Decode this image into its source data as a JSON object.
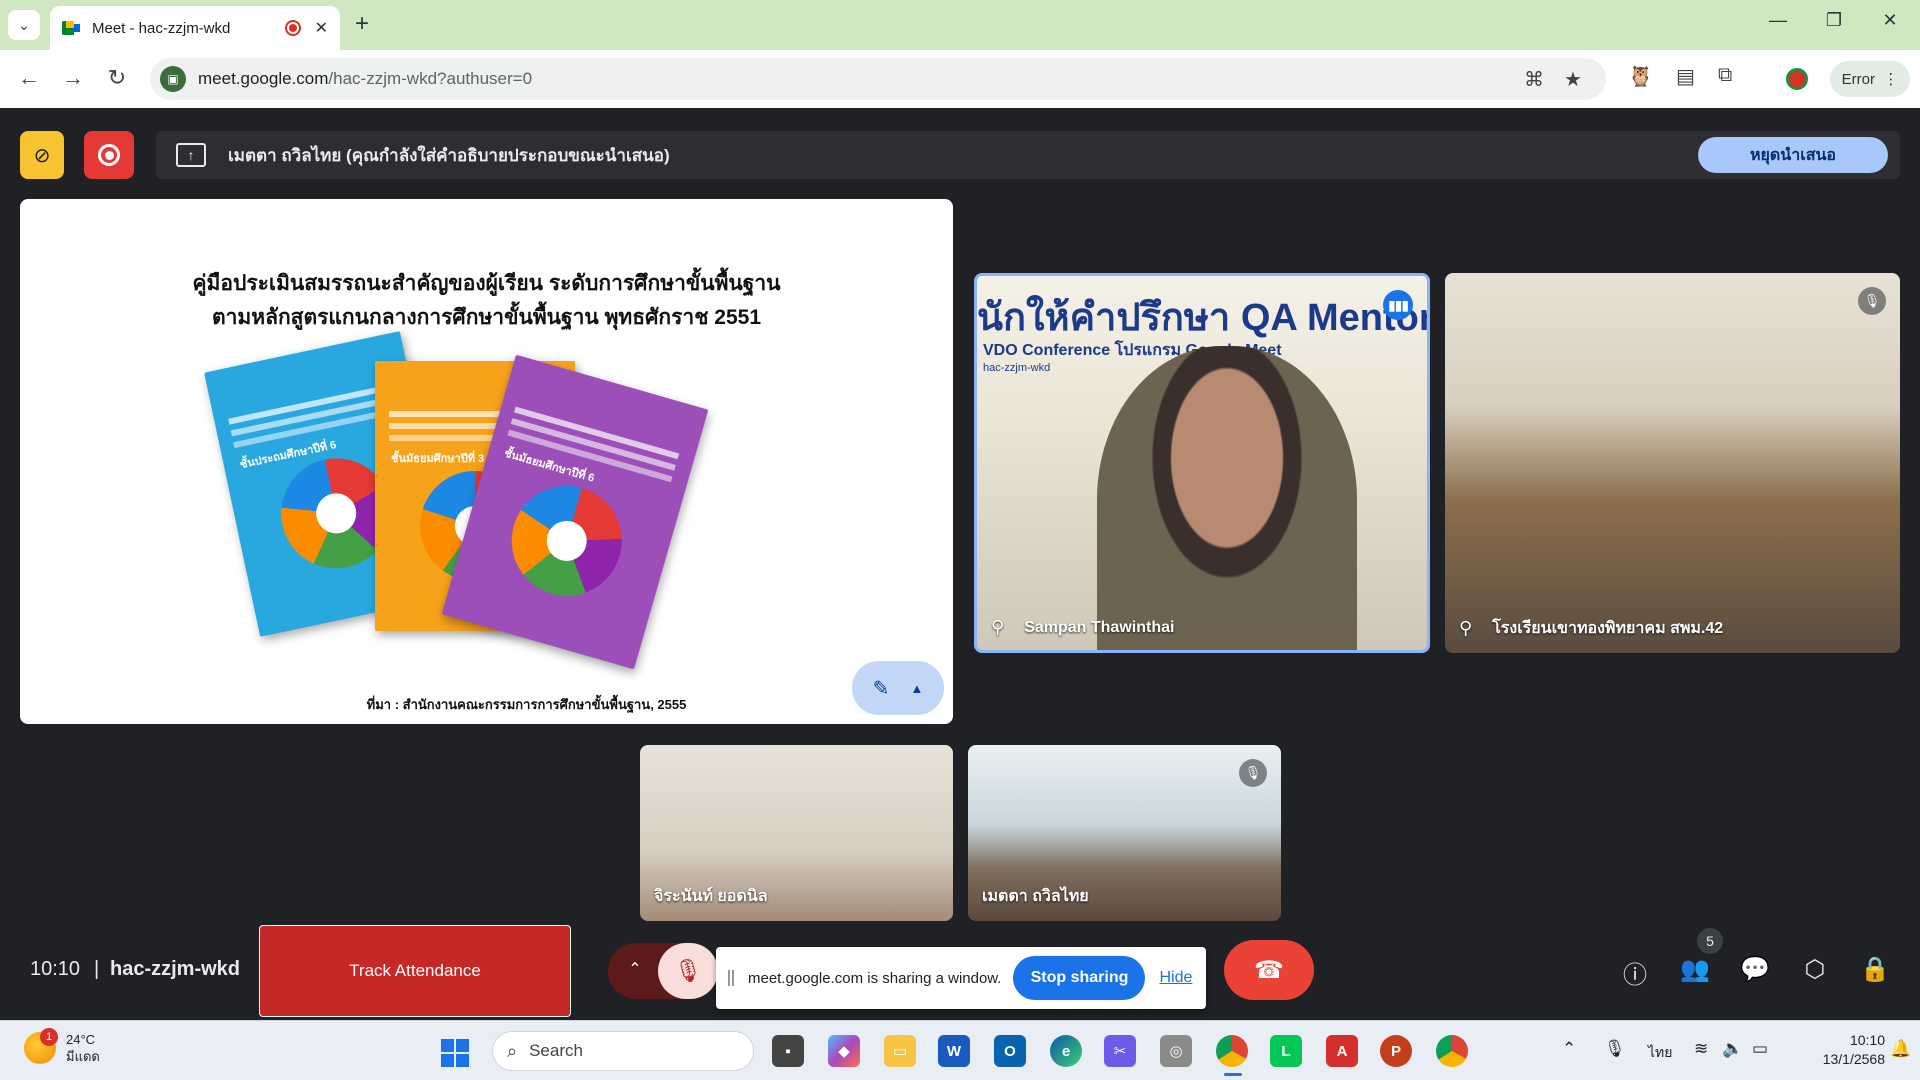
{
  "browser": {
    "tab_title": "Meet - hac-zzjm-wkd",
    "tab_close": "✕",
    "new_tab": "+",
    "url_host": "meet.google.com",
    "url_path": "/hac-zzjm-wkd?authuser=0",
    "profile_label": "Error",
    "window_controls": [
      "—",
      "❐",
      "✕"
    ]
  },
  "presenting": {
    "message": "เมตตา ถวิลไทย (คุณกำลังใส่คำอธิบายประกอบขณะนำเสนอ)",
    "stop_button": "หยุดนำเสนอ"
  },
  "slide": {
    "title_line1": "คู่มือประเมินสมรรถนะสำคัญของผู้เรียน ระดับการศึกษาขั้นพื้นฐาน",
    "title_line2": "ตามหลักสูตรแกนกลางการศึกษาขั้นพื้นฐาน พุทธศักราช 2551",
    "books": [
      {
        "label": "ชั้นประถมศึกษาปีที่ 6",
        "color": "#29a8e0"
      },
      {
        "label": "ชั้นมัธยมศึกษาปีที่ 3",
        "color": "#f7a21b"
      },
      {
        "label": "ชั้นมัธยมศึกษาปีที่ 6",
        "color": "#9c4fb8"
      }
    ],
    "source": "ที่มา : สำนักงานคณะกรรมการการศึกษาขั้นพื้นฐาน, 2555"
  },
  "participants": [
    {
      "name": "Sampan Thawinthai",
      "banner": "นักให้คำปรึกษา QA Mentor",
      "banner_sub": "VDO Conference โปรแกรม Google Meet",
      "banner_small": "hac-zzjm-wkd"
    },
    {
      "name": "โรงเรียนเขาทองพิทยาคม สพม.42"
    },
    {
      "name": "จิระนันท์ ยอดนิล"
    },
    {
      "name": "เมตตา ถวิลไทย"
    }
  ],
  "meeting": {
    "time": "10:10",
    "separator": "|",
    "code": "hac-zzjm-wkd",
    "track_attendance": "Track Attendance",
    "share_notice": "meet.google.com is sharing a window.",
    "stop_sharing": "Stop sharing",
    "hide": "Hide",
    "people_count": "5"
  },
  "taskbar": {
    "weather_temp": "24°C",
    "weather_desc": "มีแดด",
    "weather_badge": "1",
    "search_placeholder": "Search",
    "lang": "ไทย",
    "clock_time": "10:10",
    "clock_date": "13/1/2568"
  },
  "colors": {
    "tab_strip": "#cfe8c2",
    "meet_bg": "#202124",
    "accent_blue": "#1a73e8",
    "end_call_red": "#ea4335",
    "active_speaker_border": "#8ab4f8"
  }
}
